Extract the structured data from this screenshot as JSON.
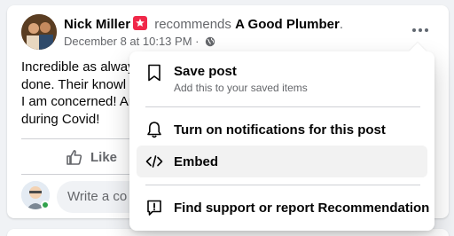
{
  "post": {
    "author": "Nick Miller",
    "recommends_text": "recommends",
    "page_name": "A Good Plumber",
    "period": ".",
    "timestamp": "December 8 at 10:13 PM",
    "separator": "·",
    "body_lines": [
      "Incredible as alway",
      "done.  Their knowl",
      "I am concerned! Ar",
      "during Covid!"
    ]
  },
  "actions": {
    "like_label": "Like"
  },
  "comment": {
    "placeholder": "Write a co"
  },
  "menu": {
    "items": [
      {
        "title": "Save post",
        "subtitle": "Add this to your saved items",
        "icon": "bookmark-icon"
      },
      {
        "title": "Turn on notifications for this post",
        "icon": "bell-icon"
      },
      {
        "title": "Embed",
        "icon": "code-icon"
      },
      {
        "title": "Find support or report Recommendation",
        "icon": "report-icon"
      }
    ]
  },
  "colors": {
    "badge": "#f02849",
    "online": "#31a24c",
    "text": "#050505",
    "secondary": "#65676b"
  }
}
